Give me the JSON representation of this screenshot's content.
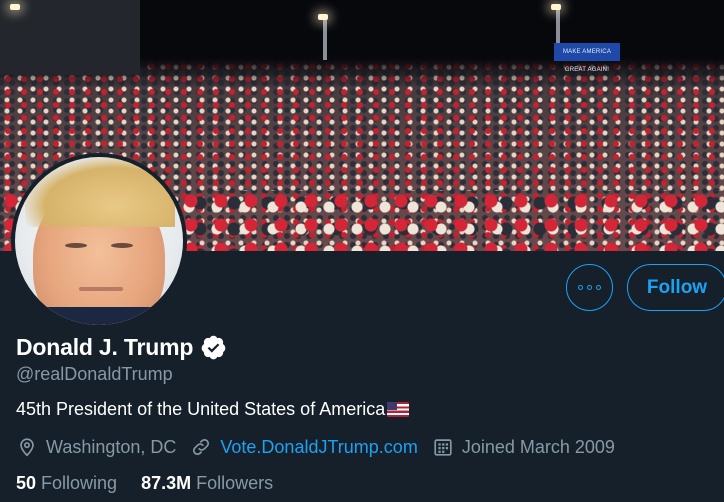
{
  "banner": {
    "screen_text": "MAKE AMERICA GREAT AGAIN!"
  },
  "profile": {
    "name": "Donald J. Trump",
    "handle": "@realDonaldTrump",
    "verified_icon": "verified-badge-icon",
    "bio": "45th President of the United States of America",
    "bio_flag_icon": "us-flag-icon",
    "location": "Washington, DC",
    "website": "Vote.DonaldJTrump.com",
    "joined": "Joined March 2009",
    "following_count": "50",
    "following_label": "Following",
    "followers_count": "87.3M",
    "followers_label": "Followers"
  },
  "actions": {
    "more_icon": "more-options-icon",
    "follow_label": "Follow"
  },
  "colors": {
    "background": "#15202b",
    "accent": "#1da1f2",
    "secondary_text": "#8899a6"
  }
}
